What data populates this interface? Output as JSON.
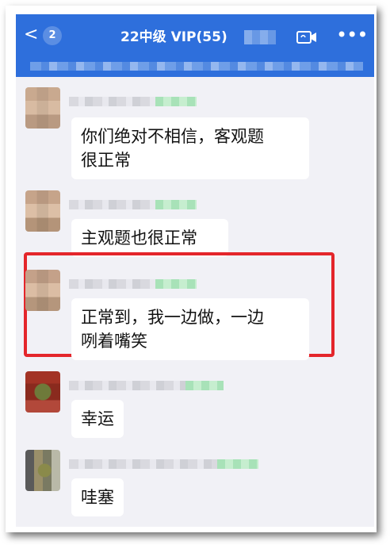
{
  "header": {
    "back_label": "<",
    "unread_badge": "2",
    "title": "22中级 VIP(55)",
    "video_icon": "video-call-icon",
    "more_icon": "more-icon"
  },
  "colors": {
    "header_bg": "#2e6fdc",
    "chat_bg": "#f1f1f6",
    "highlight": "#e4262b"
  },
  "messages": [
    {
      "text_line1": "你们绝对不相信，客观题",
      "text_line2": "很正常"
    },
    {
      "text_line1": "主观题也很正常"
    },
    {
      "text_line1": "正常到，我一边做，一边",
      "text_line2": "咧着嘴笑",
      "highlighted": true
    },
    {
      "text_line1": "幸运"
    },
    {
      "text_line1": "哇塞"
    }
  ]
}
